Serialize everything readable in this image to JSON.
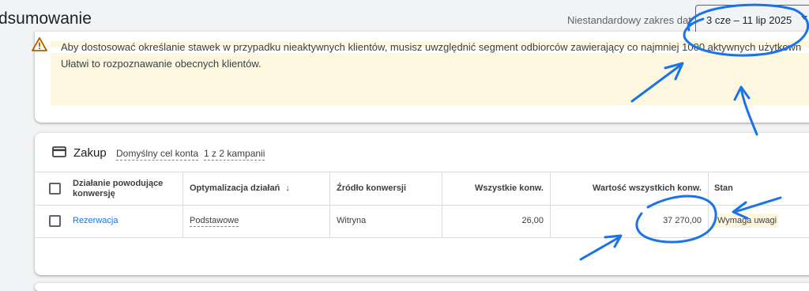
{
  "header": {
    "title": "dsumowanie",
    "range_label": "Niestandardowy zakres dat",
    "range_value": "3 cze – 11 lip 2025"
  },
  "warning": {
    "line1": "Aby dostosować określanie stawek w przypadku nieaktywnych klientów, musisz uwzględnić segment odbiorców zawierający co najmniej 1000 aktywnych użytkown",
    "line2": "Ułatwi to rozpoznawanie obecnych klientów."
  },
  "conversion_group": {
    "title": "Zakup",
    "goal_label": "Domyślny cel konta",
    "campaigns_label": "1 z 2 kampanii"
  },
  "table": {
    "headers": {
      "action_line1": "Działanie powodujące",
      "action_line2": "konwersję",
      "optimization": "Optymalizacja działań",
      "source": "Źródło konwersji",
      "all_conv": "Wszystkie konw.",
      "all_value": "Wartość wszystkich konw.",
      "status": "Stan"
    },
    "rows": [
      {
        "action": "Rezerwacja",
        "optimization": "Podstawowe",
        "source": "Witryna",
        "all_conv": "26,00",
        "all_value": "37 270,00",
        "status": "Wymaga uwagi"
      }
    ]
  },
  "colors": {
    "link": "#1a73e8",
    "warning_bg": "#fef7e0",
    "annotation": "#1a73e8"
  }
}
